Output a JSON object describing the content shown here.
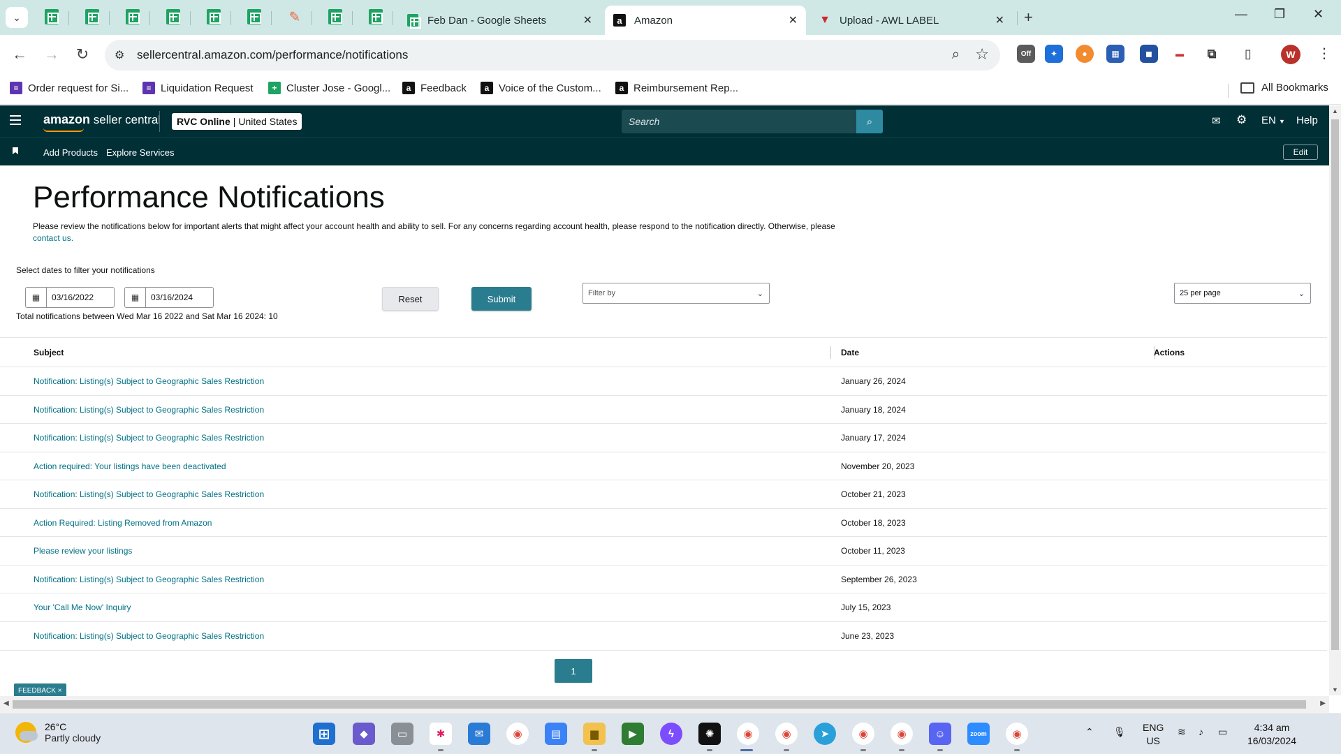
{
  "browser": {
    "tabs": [
      {
        "title": "Feb Dan - Google Sheets",
        "icon": "google-sheets-icon"
      },
      {
        "title": "Amazon",
        "icon": "amazon-icon",
        "active": true
      },
      {
        "title": "Upload - AWL LABEL",
        "icon": "awl-icon"
      }
    ],
    "url": "sellercentral.amazon.com/performance/notifications",
    "profile_initial": "W",
    "bookmarks": [
      {
        "label": "Order request for Si...",
        "icon": "forms-icon"
      },
      {
        "label": "Liquidation Request",
        "icon": "forms-icon"
      },
      {
        "label": "Cluster Jose - Googl...",
        "icon": "google-sheets-icon"
      },
      {
        "label": "Feedback",
        "icon": "amazon-icon"
      },
      {
        "label": "Voice of the Custom...",
        "icon": "amazon-icon"
      },
      {
        "label": "Reimbursement Rep...",
        "icon": "amazon-icon"
      }
    ],
    "all_bookmarks": "All Bookmarks",
    "ext_badge": "Off"
  },
  "header": {
    "logo": "amazon seller central",
    "logo_brand": "amazon",
    "logo_product": "seller central",
    "store": "RVC Online",
    "marketplace": "United States",
    "search_placeholder": "Search",
    "language": "EN",
    "help": "Help",
    "nav": {
      "add_products": "Add Products",
      "explore_services": "Explore Services",
      "edit": "Edit"
    }
  },
  "page": {
    "title": "Performance Notifications",
    "intro": "Please review the notifications below for important alerts that might affect your account health and ability to sell. For any concerns regarding account health, please respond to the notification directly. Otherwise, please",
    "contact_link": "contact us.",
    "filter_label": "Select dates to filter your notifications",
    "date_from": "03/16/2022",
    "date_to": "03/16/2024",
    "reset": "Reset",
    "submit": "Submit",
    "filter_placeholder": "Filter by",
    "per_page": "25 per page",
    "total": "Total notifications between Wed Mar 16 2022 and Sat Mar 16 2024: 10",
    "columns": {
      "subject": "Subject",
      "date": "Date",
      "actions": "Actions"
    },
    "rows": [
      {
        "subject": "Notification: Listing(s) Subject to Geographic Sales Restriction",
        "date": "January 26, 2024"
      },
      {
        "subject": "Notification: Listing(s) Subject to Geographic Sales Restriction",
        "date": "January 18, 2024"
      },
      {
        "subject": "Notification: Listing(s) Subject to Geographic Sales Restriction",
        "date": "January 17, 2024"
      },
      {
        "subject": "Action required: Your listings have been deactivated",
        "date": "November 20, 2023"
      },
      {
        "subject": "Notification: Listing(s) Subject to Geographic Sales Restriction",
        "date": "October 21, 2023"
      },
      {
        "subject": "Action Required: Listing Removed from Amazon",
        "date": "October 18, 2023"
      },
      {
        "subject": "Please review your listings",
        "date": "October 11, 2023"
      },
      {
        "subject": "Notification: Listing(s) Subject to Geographic Sales Restriction",
        "date": "September 26, 2023"
      },
      {
        "subject": "Your 'Call Me Now' Inquiry",
        "date": "July 15, 2023"
      },
      {
        "subject": "Notification: Listing(s) Subject to Geographic Sales Restriction",
        "date": "June 23, 2023"
      }
    ],
    "current_page": "1",
    "feedback": "FEEDBACK ×"
  },
  "taskbar": {
    "temperature": "26°C",
    "weather": "Partly cloudy",
    "lang_top": "ENG",
    "lang_bottom": "US",
    "time": "4:34 am",
    "date": "16/03/2024"
  },
  "colors": {
    "header_bg": "#002f36",
    "link": "#007185",
    "accent": "#2a7d8f"
  }
}
